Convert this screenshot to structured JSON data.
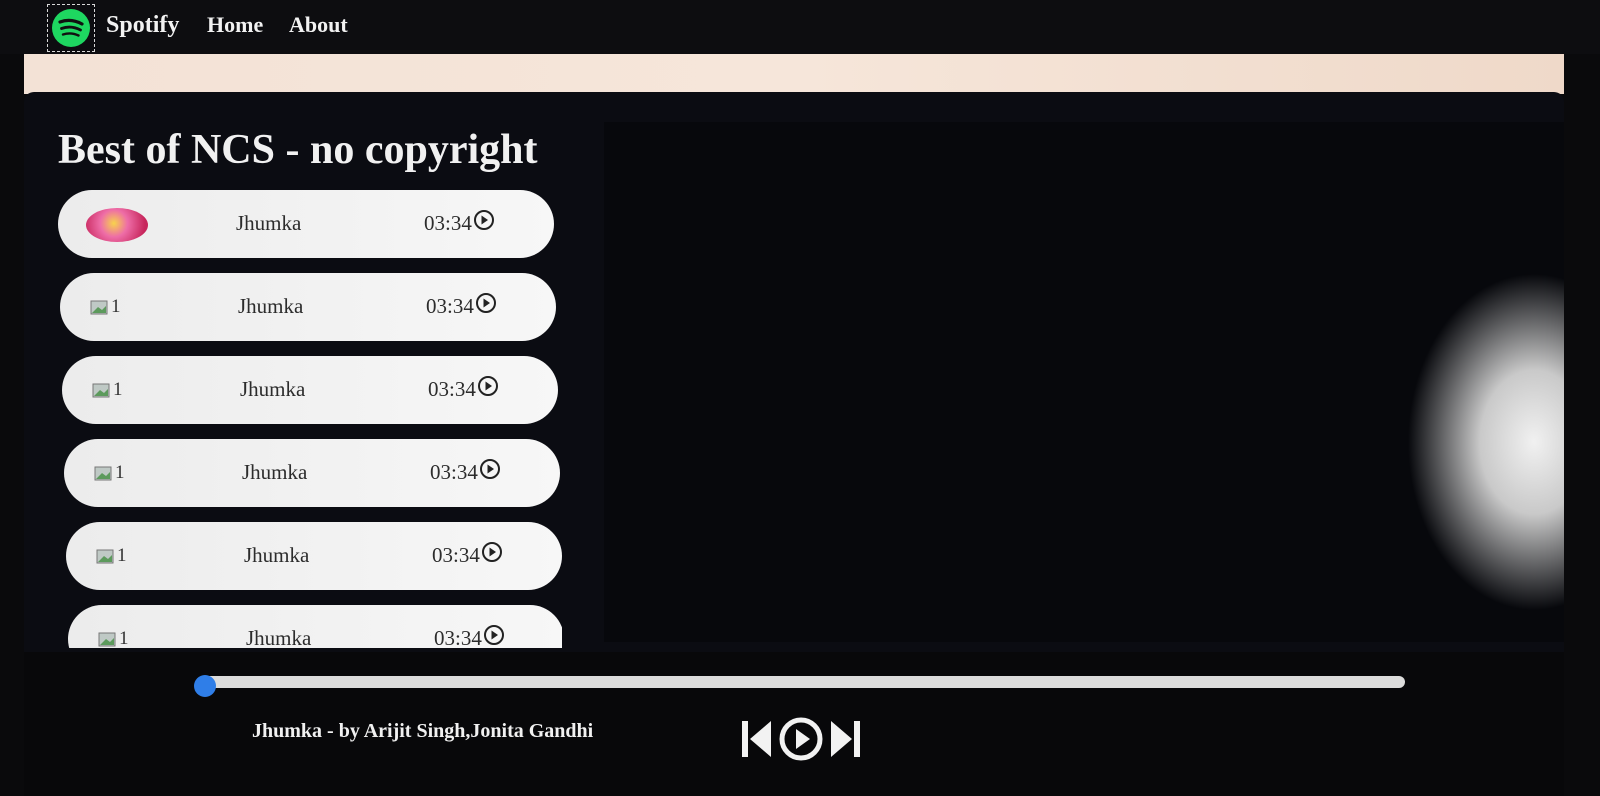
{
  "navbar": {
    "brand": "Spotify",
    "links": [
      "Home",
      "About"
    ]
  },
  "playlist": {
    "title": "Best of NCS - no copyright",
    "songs": [
      {
        "name": "Jhumka",
        "time": "03:34",
        "thumb": "cover"
      },
      {
        "name": "Jhumka",
        "time": "03:34",
        "thumb_alt": "1"
      },
      {
        "name": "Jhumka",
        "time": "03:34",
        "thumb_alt": "1"
      },
      {
        "name": "Jhumka",
        "time": "03:34",
        "thumb_alt": "1"
      },
      {
        "name": "Jhumka",
        "time": "03:34",
        "thumb_alt": "1"
      },
      {
        "name": "Jhumka",
        "time": "03:34",
        "thumb_alt": "1"
      }
    ]
  },
  "player": {
    "progress": 0,
    "now_playing": "Jhumka - by Arijit Singh,Jonita Gandhi",
    "icons": [
      "previous-icon",
      "play-icon",
      "next-icon"
    ]
  },
  "colors": {
    "background": "#0a0a0c",
    "brand_green": "#1ed760",
    "strip": "#f3e2d6",
    "progress_thumb": "#2f7ee8"
  }
}
